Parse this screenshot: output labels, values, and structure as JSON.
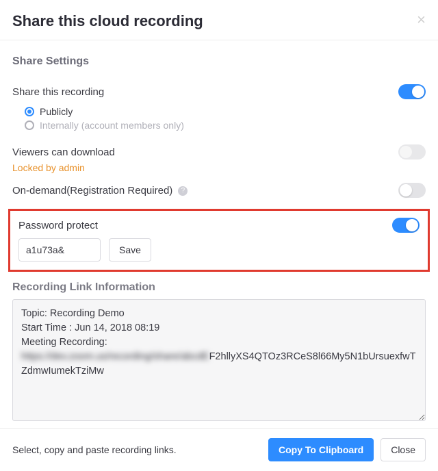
{
  "modal": {
    "title": "Share this cloud recording",
    "close": "×"
  },
  "section_title": "Share Settings",
  "share": {
    "label": "Share this recording",
    "public_label": "Publicly",
    "internal_label": "Internally (account members only)"
  },
  "download": {
    "label": "Viewers can download",
    "locked_text": "Locked by admin"
  },
  "ondemand": {
    "label": "On-demand(Registration Required)"
  },
  "password": {
    "label": "Password protect",
    "value": "a1u73a&",
    "save_label": "Save"
  },
  "link_info": {
    "title": "Recording Link Information",
    "text_lines": {
      "topic": "Topic: Recording Demo",
      "start": "Start Time : Jun 14, 2018 08:19",
      "blank": "",
      "header": "Meeting Recording:",
      "blurred": "https://dev.zoom.us/recording/share/abcdE",
      "tail": "F2hllyXS4QTOz3RCeS8l66My5N1bUrsuexfwTZdmwIumekTziMw"
    }
  },
  "footer": {
    "hint": "Select, copy and paste recording links.",
    "copy_label": "Copy To Clipboard",
    "close_label": "Close"
  },
  "toggle_states": {
    "share": true,
    "download": false,
    "ondemand": false,
    "password": true
  },
  "colors": {
    "accent": "#2D8CFF",
    "warning": "#e8912b",
    "highlight_border": "#e03a2f"
  }
}
